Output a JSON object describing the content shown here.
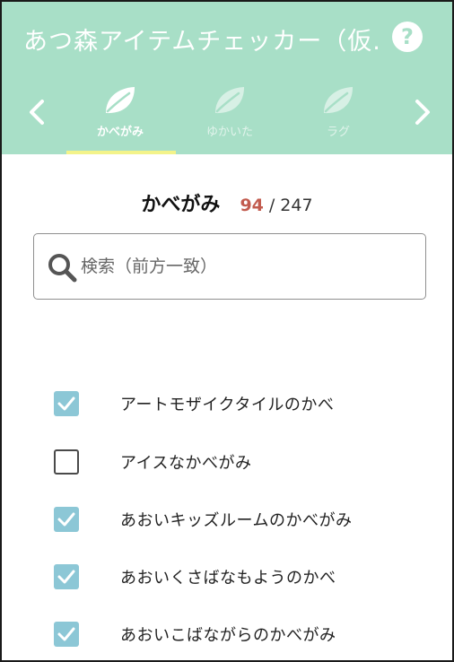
{
  "app": {
    "title": "あつ森アイテムチェッカー（仮..."
  },
  "tabs": [
    {
      "label": "かべがみ",
      "active": true
    },
    {
      "label": "ゆかいた",
      "active": false
    },
    {
      "label": "ラグ",
      "active": false
    }
  ],
  "category": {
    "title": "かべがみ",
    "checked_count": "94",
    "separator": "/",
    "total": "247"
  },
  "search": {
    "placeholder": "検索（前方一致）",
    "value": ""
  },
  "items": [
    {
      "label": "アートモザイクタイルのかべ",
      "checked": true
    },
    {
      "label": "アイスなかべがみ",
      "checked": false
    },
    {
      "label": "あおいキッズルームのかべがみ",
      "checked": true
    },
    {
      "label": "あおいくさばなもようのかべ",
      "checked": true
    },
    {
      "label": "あおいこばながらのかべがみ",
      "checked": true
    }
  ],
  "icons": {
    "help": "help-icon",
    "prev": "chevron-left-icon",
    "next": "chevron-right-icon",
    "tab": "leaf-icon",
    "search": "search-icon",
    "check": "check-icon"
  },
  "colors": {
    "header_bg": "#a8dfc7",
    "tab_indicator": "#f3f38a",
    "count_color": "#c25b4e",
    "checkbox_checked": "#8cc7d6"
  }
}
